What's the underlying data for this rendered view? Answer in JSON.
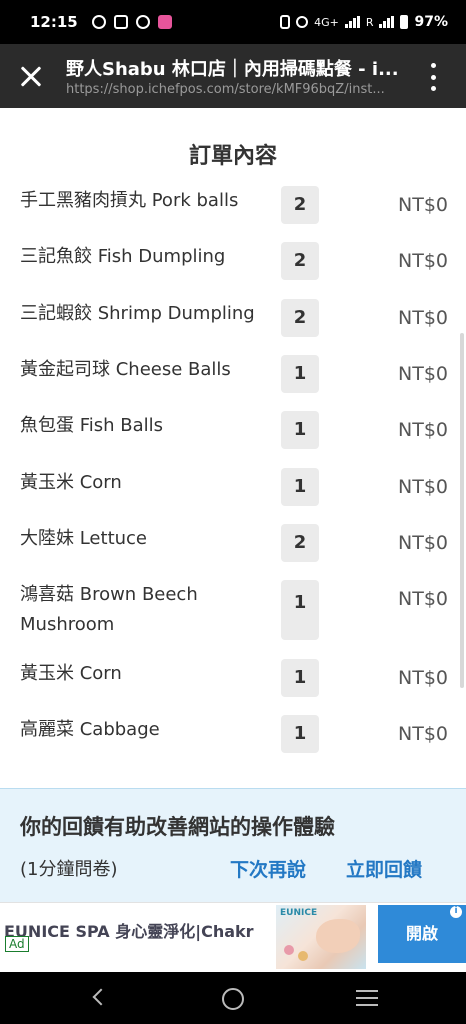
{
  "status_bar": {
    "time": "12:15",
    "network": "4G+",
    "carrier_flag": "R",
    "battery": "97%",
    "icons": [
      "chat-bubble-icon",
      "calendar-31-icon",
      "q-app-icon",
      "pink-app-icon",
      "vibrate-icon",
      "volte-icon",
      "wifi-icon",
      "signal-icon",
      "battery-icon"
    ]
  },
  "browser": {
    "title": "野人Shabu 林口店｜內用掃碼點餐 - i...",
    "url": "https://shop.ichefpos.com/store/kMF96bqZ/inst...",
    "icons": [
      "close-icon",
      "kebab-menu-icon"
    ]
  },
  "order": {
    "title": "訂單內容",
    "items": [
      {
        "name": "手工黑豬肉摃丸 Pork balls",
        "qty": "2",
        "price": "NT$0"
      },
      {
        "name": "三記魚餃 Fish Dumpling",
        "qty": "2",
        "price": "NT$0"
      },
      {
        "name": "三記蝦餃 Shrimp Dumpling",
        "qty": "2",
        "price": "NT$0"
      },
      {
        "name": "黃金起司球 Cheese Balls",
        "qty": "1",
        "price": "NT$0"
      },
      {
        "name": "魚包蛋 Fish Balls",
        "qty": "1",
        "price": "NT$0"
      },
      {
        "name": "黃玉米 Corn",
        "qty": "1",
        "price": "NT$0"
      },
      {
        "name": "大陸妹 Lettuce",
        "qty": "2",
        "price": "NT$0"
      },
      {
        "name": "鴻喜菇 Brown Beech Mushroom",
        "qty": "1",
        "price": "NT$0"
      },
      {
        "name": "黃玉米 Corn",
        "qty": "1",
        "price": "NT$0"
      },
      {
        "name": "高麗菜 Cabbage",
        "qty": "1",
        "price": "NT$0"
      }
    ]
  },
  "feedback": {
    "title": "你的回饋有助改善網站的操作體驗",
    "subtitle": "(1分鐘問卷)",
    "later": "下次再說",
    "now": "立即回饋"
  },
  "ad": {
    "text": "EUNICE SPA 身心靈淨化|Chakr",
    "badge": "Ad",
    "image_text": "EUNICE",
    "cta": "開啟",
    "info": "i"
  },
  "colors": {
    "feedback_bg": "#e6f3fb",
    "feedback_link": "#2378c4",
    "ad_cta": "#2f8ad8",
    "qty_bg": "#ebebeb"
  }
}
